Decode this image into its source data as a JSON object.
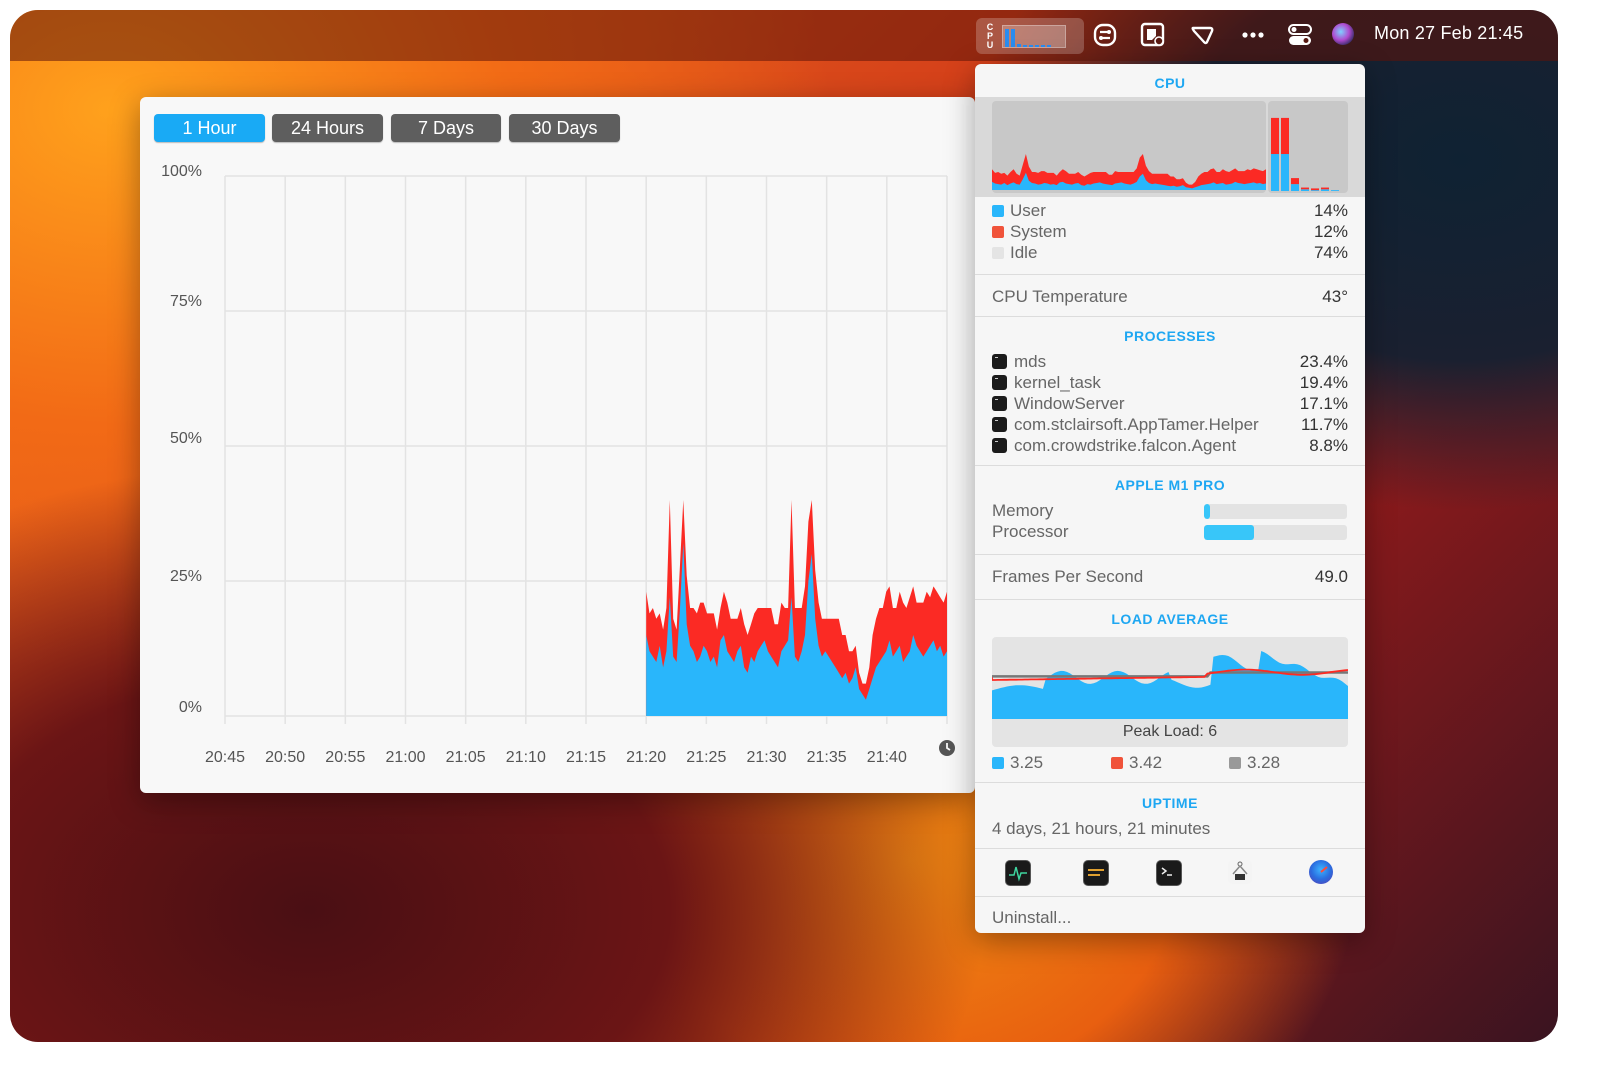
{
  "menubar": {
    "cpu_widget_label": "CPU",
    "cpu_widget_bars": [
      0.9,
      0.9,
      0.15,
      0.05,
      0.05,
      0.05,
      0.05,
      0.05
    ],
    "icons": [
      "cpu-monitor-icon",
      "shortcuts-icon",
      "screen-note-icon",
      "tag-icon",
      "more-icon",
      "control-center-icon",
      "siri-icon"
    ],
    "clock": "Mon 27 Feb  21:45"
  },
  "history": {
    "tabs": [
      {
        "label": "1 Hour",
        "active": true
      },
      {
        "label": "24 Hours",
        "active": false
      },
      {
        "label": "7 Days",
        "active": false
      },
      {
        "label": "30 Days",
        "active": false
      }
    ],
    "clock_icon": "clock-icon"
  },
  "chart_data": {
    "type": "area",
    "title": "",
    "xlabel": "",
    "ylabel": "",
    "x_ticks": [
      "20:45",
      "20:50",
      "20:55",
      "21:00",
      "21:05",
      "21:10",
      "21:15",
      "21:20",
      "21:25",
      "21:30",
      "21:35",
      "21:40"
    ],
    "y_ticks": [
      "100%",
      "75%",
      "50%",
      "25%",
      "0%"
    ],
    "ylim": [
      0,
      100
    ],
    "x_range_minutes": [
      0,
      60
    ],
    "data_start_minute": 35,
    "grid": true,
    "series": [
      {
        "name": "User",
        "color": "#29b6fb",
        "samples": [
          15,
          12,
          11,
          10,
          13,
          9,
          12,
          14,
          11,
          10,
          20,
          32,
          17,
          13,
          12,
          10,
          11,
          13,
          12,
          10,
          11,
          9,
          14,
          15,
          12,
          11,
          10,
          12,
          13,
          9,
          8,
          11,
          10,
          12,
          13,
          14,
          12,
          11,
          10,
          9,
          12,
          13,
          14,
          12,
          11,
          10,
          12,
          15,
          25,
          30,
          18,
          13,
          11,
          12,
          11,
          10,
          9,
          8,
          7,
          8,
          6,
          7,
          9,
          5,
          4,
          3,
          5,
          7,
          9,
          10,
          11,
          12,
          14,
          11,
          12,
          13,
          10,
          11,
          12,
          15,
          13,
          12,
          11,
          12,
          13,
          14,
          12,
          13,
          11,
          12
        ]
      },
      {
        "name": "System",
        "color": "#fb2a24",
        "samples": [
          8,
          7,
          9,
          8,
          6,
          7,
          8,
          9,
          7,
          6,
          8,
          8,
          9,
          7,
          8,
          9,
          10,
          8,
          7,
          9,
          8,
          7,
          6,
          8,
          9,
          7,
          8,
          6,
          7,
          8,
          7,
          6,
          9,
          8,
          7,
          6,
          8,
          9,
          7,
          8,
          9,
          7,
          6,
          8,
          9,
          10,
          8,
          9,
          11,
          10,
          9,
          8,
          7,
          6,
          7,
          8,
          9,
          10,
          8,
          7,
          6,
          5,
          4,
          3,
          2,
          3,
          4,
          8,
          9,
          10,
          9,
          11,
          10,
          9,
          8,
          10,
          11,
          9,
          10,
          9,
          8,
          9,
          10,
          11,
          9,
          10,
          11,
          9,
          10,
          11
        ]
      }
    ],
    "peaks": [
      {
        "time": "21:22",
        "value": 40
      },
      {
        "time": "21:32",
        "value": 40
      }
    ]
  },
  "panel": {
    "cpu": {
      "title": "CPU",
      "legend": [
        {
          "label": "User",
          "value": "14%",
          "color": "#29b6fb"
        },
        {
          "label": "System",
          "value": "12%",
          "color": "#f0533a"
        },
        {
          "label": "Idle",
          "value": "74%",
          "color": "#e4e4e4"
        }
      ],
      "core_bars": [
        {
          "user": 0.43,
          "system": 0.42
        },
        {
          "user": 0.43,
          "system": 0.42
        },
        {
          "user": 0.08,
          "system": 0.07
        },
        {
          "user": 0.02,
          "system": 0.02
        },
        {
          "user": 0.01,
          "system": 0.02
        },
        {
          "user": 0.02,
          "system": 0.02
        },
        {
          "user": 0.01,
          "system": 0.0
        }
      ]
    },
    "temperature": {
      "label": "CPU Temperature",
      "value": "43°"
    },
    "processes": {
      "title": "PROCESSES",
      "items": [
        {
          "name": "mds",
          "value": "23.4%"
        },
        {
          "name": "kernel_task",
          "value": "19.4%"
        },
        {
          "name": "WindowServer",
          "value": "17.1%"
        },
        {
          "name": "com.stclairsoft.AppTamer.Helper",
          "value": "11.7%"
        },
        {
          "name": "com.crowdstrike.falcon.Agent",
          "value": "8.8%"
        }
      ]
    },
    "gpu": {
      "title": "APPLE M1 PRO",
      "memory_label": "Memory",
      "memory_fraction": 0.04,
      "processor_label": "Processor",
      "processor_fraction": 0.35
    },
    "fps": {
      "label": "Frames Per Second",
      "value": "49.0"
    },
    "load": {
      "title": "LOAD AVERAGE",
      "peak_label": "Peak Load: 6",
      "values": [
        {
          "value": "3.25",
          "color": "#29b6fb"
        },
        {
          "value": "3.42",
          "color": "#f0533a"
        },
        {
          "value": "3.28",
          "color": "#999999"
        }
      ]
    },
    "uptime": {
      "title": "UPTIME",
      "value": "4 days, 21 hours, 21 minutes"
    },
    "apps": [
      "activity-monitor-icon",
      "console-icon",
      "terminal-icon",
      "system-information-icon",
      "istat-icon"
    ],
    "uninstall_label": "Uninstall..."
  }
}
